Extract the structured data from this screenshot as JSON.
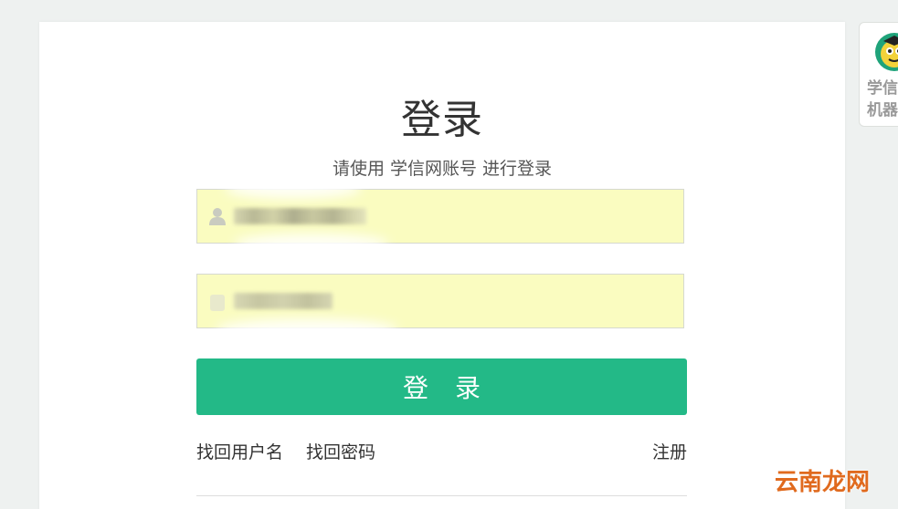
{
  "login": {
    "title": "登录",
    "subtitle": "请使用 学信网账号 进行登录",
    "username_value": "",
    "password_value": "",
    "submit_label": "登 录"
  },
  "links": {
    "recover_username": "找回用户名",
    "recover_password": "找回密码",
    "register": "注册"
  },
  "side_widget": {
    "label": "学信\n机器"
  },
  "watermark": {
    "text": "云南龙网"
  },
  "colors": {
    "accent": "#23b987",
    "autofill": "#fafcc0",
    "background": "#eef1f0"
  },
  "icons": {
    "username": "user-icon",
    "password": "lock-icon",
    "robot": "robot-avatar-icon"
  }
}
